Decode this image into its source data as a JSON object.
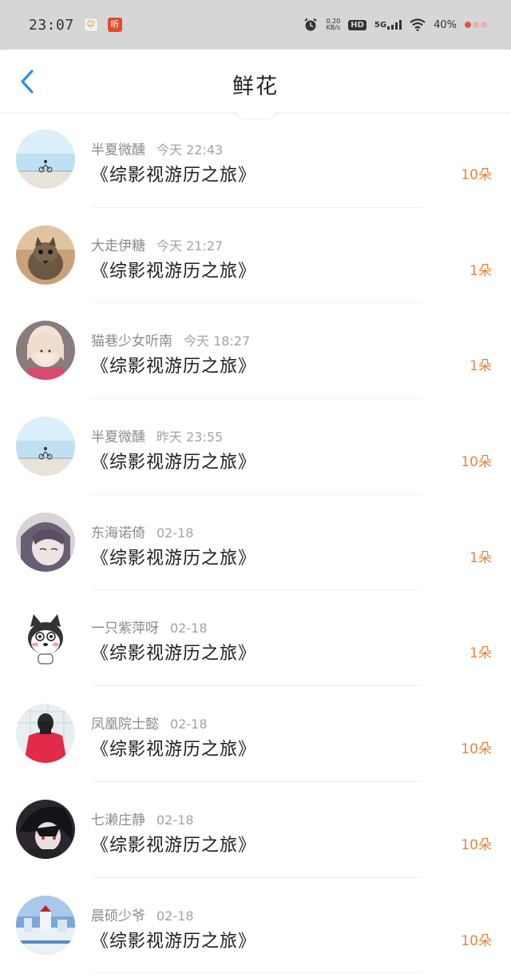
{
  "status_bar": {
    "time": "23:07",
    "app_icon_label": "听",
    "net_speed_value": "0.20",
    "net_speed_unit": "KB/s",
    "hd_label": "HD",
    "network_label": "5G",
    "battery": "40%"
  },
  "header": {
    "title": "鲜花"
  },
  "accent_color": "#2c8fe0",
  "count_color": "#e8843c",
  "items": [
    {
      "user": "半夏微醺",
      "time": "今天 22:43",
      "book": "《综影视游历之旅》",
      "count": "10朵",
      "avatar": "bike-sky-avatar"
    },
    {
      "user": "大走伊糖",
      "time": "今天 21:27",
      "book": "《综影视游历之旅》",
      "count": "1朵",
      "avatar": "cat-avatar"
    },
    {
      "user": "猫巷少女听南",
      "time": "今天 18:27",
      "book": "《综影视游历之旅》",
      "count": "1朵",
      "avatar": "girl-photo-avatar"
    },
    {
      "user": "半夏微醺",
      "time": "昨天 23:55",
      "book": "《综影视游历之旅》",
      "count": "10朵",
      "avatar": "bike-sky-avatar"
    },
    {
      "user": "东海诺倚",
      "time": "02-18",
      "book": "《综影视游历之旅》",
      "count": "1朵",
      "avatar": "anime-girl-avatar"
    },
    {
      "user": "一只紫萍呀",
      "time": "02-18",
      "book": "《综影视游历之旅》",
      "count": "1朵",
      "avatar": "husky-cartoon-avatar"
    },
    {
      "user": "凤凰院士懿",
      "time": "02-18",
      "book": "《综影视游历之旅》",
      "count": "10朵",
      "avatar": "boy-red-shirt-avatar"
    },
    {
      "user": "七濑庄静",
      "time": "02-18",
      "book": "《综影视游历之旅》",
      "count": "10朵",
      "avatar": "anime-boy-avatar"
    },
    {
      "user": "晨硕少爷",
      "time": "02-18",
      "book": "《综影视游历之旅》",
      "count": "10朵",
      "avatar": "snow-scene-avatar"
    }
  ]
}
